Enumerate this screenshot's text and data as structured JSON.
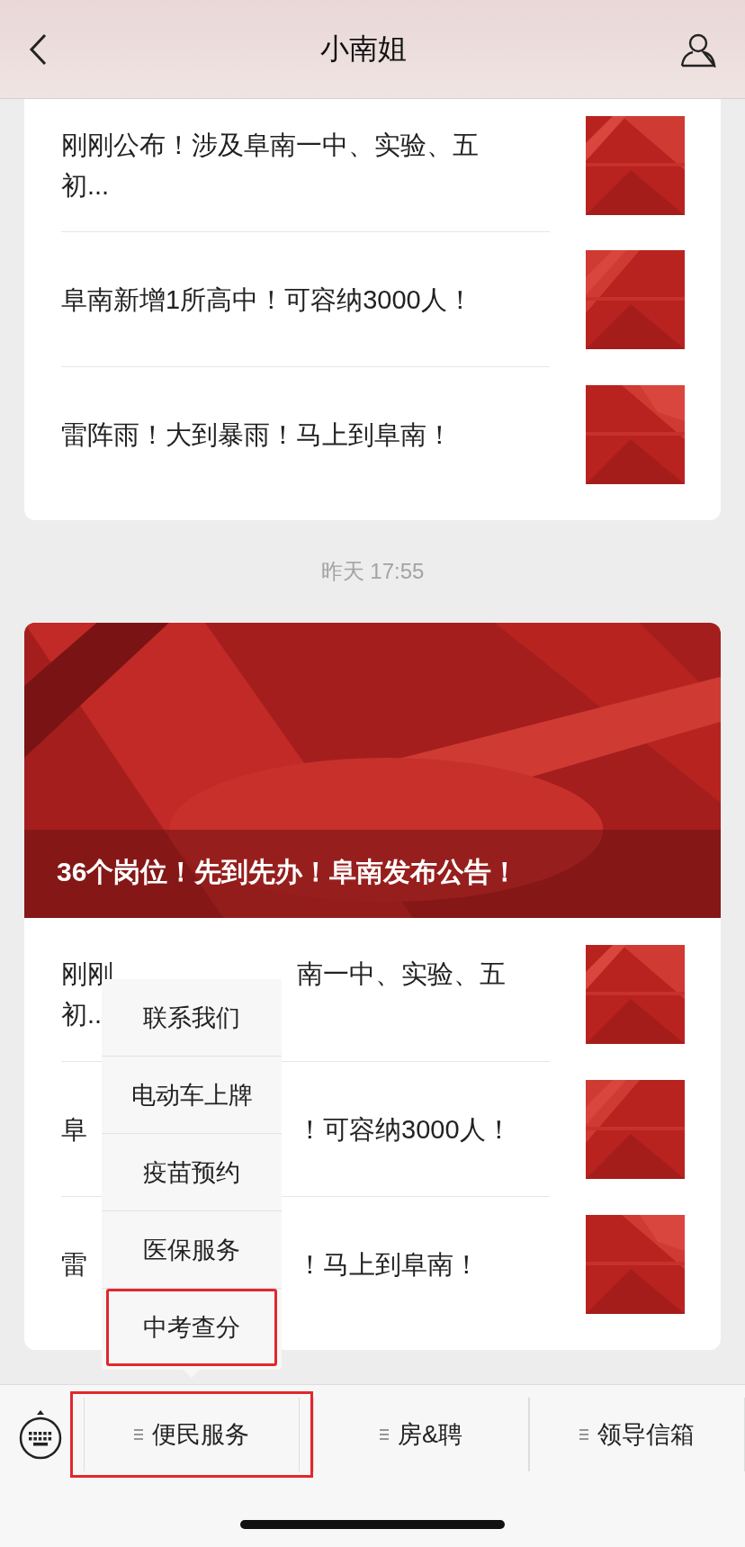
{
  "header": {
    "title": "小南姐"
  },
  "group_1": {
    "articles": [
      {
        "title": "刚刚公布！涉及阜南一中、实验、五初..."
      },
      {
        "title": "阜南新增1所高中！可容纳3000人！"
      },
      {
        "title": "雷阵雨！大到暴雨！马上到阜南！"
      }
    ]
  },
  "timestamp": "昨天 17:55",
  "group_2": {
    "cover": {
      "caption": "36个岗位！先到先办！阜南发布公告！"
    },
    "articles": [
      {
        "left": "刚刚",
        "right": "南一中、实验、五",
        "left_line_2": "初.."
      },
      {
        "left": "阜",
        "right": "！可容纳3000人！"
      },
      {
        "left": "雷",
        "right": "！马上到阜南！"
      }
    ]
  },
  "menu_bar": {
    "tabs": [
      {
        "label": "便民服务",
        "highlighted": true,
        "submenu": [
          {
            "label": "联系我们",
            "highlighted": false
          },
          {
            "label": "电动车上牌",
            "highlighted": false
          },
          {
            "label": "疫苗预约",
            "highlighted": false
          },
          {
            "label": "医保服务",
            "highlighted": false
          },
          {
            "label": "中考查分",
            "highlighted": true
          }
        ]
      },
      {
        "label": "房&聘",
        "highlighted": false
      },
      {
        "label": "领导信箱",
        "highlighted": false
      }
    ]
  }
}
